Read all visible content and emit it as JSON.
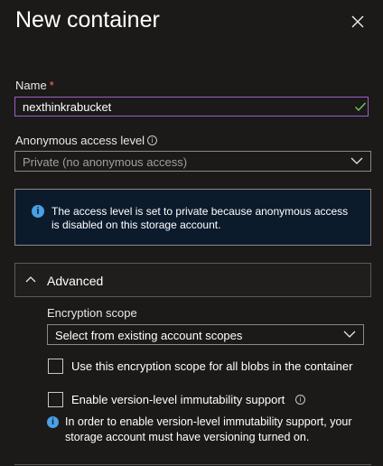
{
  "panel": {
    "title": "New container"
  },
  "name_field": {
    "label": "Name",
    "required_mark": "*",
    "value": "nexthinkrabucket"
  },
  "access_level": {
    "label": "Anonymous access level",
    "selected": "Private (no anonymous access)"
  },
  "info_message": {
    "text": "The access level is set to private because anonymous access is disabled on this storage account."
  },
  "advanced": {
    "label": "Advanced",
    "encryption_scope_label": "Encryption scope",
    "encryption_scope_selected": "Select from existing account scopes",
    "use_scope_checkbox_label": "Use this encryption scope for all blobs in the container",
    "immutability_checkbox_label": "Enable version-level immutability support",
    "immutability_note": "In order to enable version-level immutability support, your storage account must have versioning turned on."
  },
  "colors": {
    "background": "#1b1a19",
    "input_focus_border": "#9d5ecb",
    "info_blue": "#4aa0e6",
    "valid_check": "#6ccb5f"
  }
}
